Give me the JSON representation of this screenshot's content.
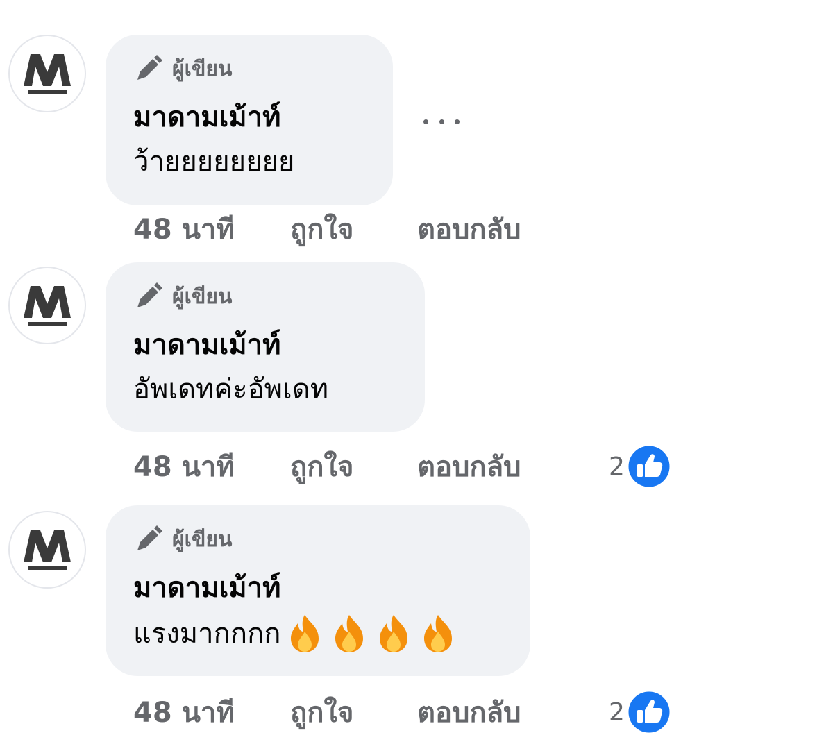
{
  "comments": [
    {
      "avatar_icon": "brand-logo-avatar",
      "badge_icon": "pencil-icon",
      "badge_label": "ผู้เขียน",
      "author": "มาดามเม้าท์",
      "text": "ว้ายยยยยยยย",
      "emoji": [],
      "time": "48 นาที",
      "like_label": "ถูกใจ",
      "reply_label": "ตอบกลับ",
      "reaction_count": null,
      "show_more": true,
      "more_icon": "ellipsis-icon"
    },
    {
      "avatar_icon": "brand-logo-avatar",
      "badge_icon": "pencil-icon",
      "badge_label": "ผู้เขียน",
      "author": "มาดามเม้าท์",
      "text": "อัพเดทค่ะอัพเดท",
      "emoji": [],
      "time": "48 นาที",
      "like_label": "ถูกใจ",
      "reply_label": "ตอบกลับ",
      "reaction_count": "2",
      "reaction_icon": "like-icon",
      "show_more": false
    },
    {
      "avatar_icon": "brand-logo-avatar",
      "badge_icon": "pencil-icon",
      "badge_label": "ผู้เขียน",
      "author": "มาดามเม้าท์",
      "text": "แรงมากกกก",
      "emoji": [
        "fire-icon",
        "fire-icon",
        "fire-icon",
        "fire-icon"
      ],
      "time": "48 นาที",
      "like_label": "ถูกใจ",
      "reply_label": "ตอบกลับ",
      "reaction_count": "2",
      "reaction_icon": "like-icon",
      "show_more": false
    }
  ],
  "colors": {
    "bubble_bg": "#f0f2f5",
    "meta_text": "#65676b",
    "like_blue": "#1877f2",
    "fire_orange": "#f4900c",
    "fire_yellow": "#ffcc4d"
  }
}
